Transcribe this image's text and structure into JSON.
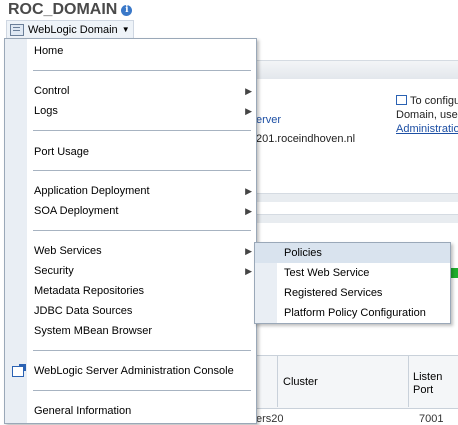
{
  "header": {
    "domain_title": "ROC_DOMAIN",
    "menu_label": "WebLogic Domain"
  },
  "background": {
    "server_link_text": "erver",
    "host_text": "201.roceindhoven.nl",
    "config_lines": [
      "To configu",
      "Domain, use t",
      "Administration"
    ],
    "table_headers": {
      "cluster": "Cluster",
      "listen_port": [
        "Listen",
        "Port"
      ]
    },
    "row_cells": [
      "ers20",
      "7001"
    ]
  },
  "menu": {
    "items": {
      "home": "Home",
      "control": "Control",
      "logs": "Logs",
      "port_usage": "Port Usage",
      "application_deployment": "Application Deployment",
      "soa_deployment": "SOA Deployment",
      "web_services": "Web Services",
      "security": "Security",
      "metadata_repositories": "Metadata Repositories",
      "jdbc_data_sources": "JDBC Data Sources",
      "system_mbean_browser": "System MBean Browser",
      "admin_console": "WebLogic Server Administration Console",
      "general_information": "General Information"
    }
  },
  "submenu": {
    "items": [
      "Policies",
      "Test Web Service",
      "Registered Services",
      "Platform Policy Configuration"
    ],
    "highlighted": "Policies"
  },
  "colors": {
    "highlight": "#d9e3ee",
    "link": "#1d4fa4",
    "status_green": "#1fae2d"
  }
}
